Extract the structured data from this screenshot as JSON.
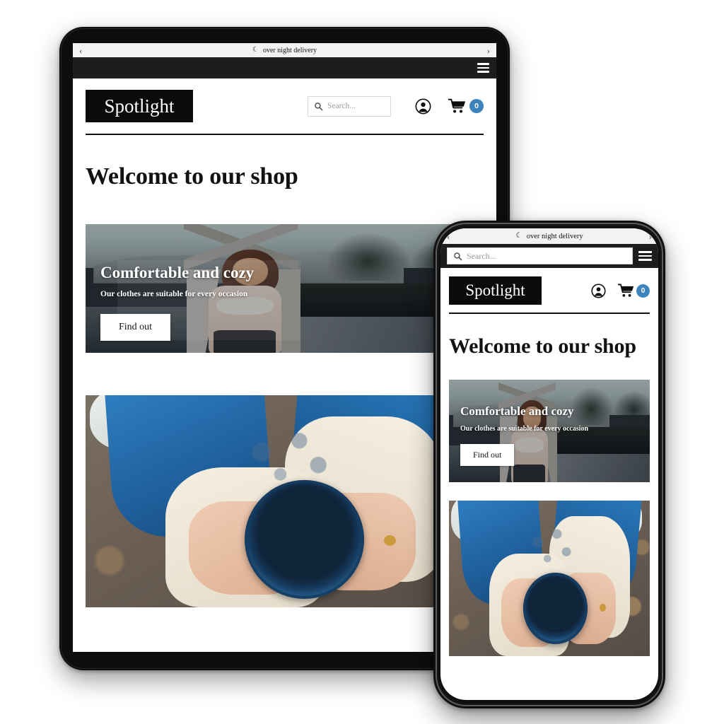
{
  "brand": {
    "name": "Spotlight",
    "accent_badge_color": "#3d84bd",
    "ink": "#0b0b0b"
  },
  "announcement": {
    "text": "over night delivery",
    "moon_icon": "☾",
    "prev_arrow": "‹",
    "next_arrow": "›"
  },
  "search": {
    "placeholder": "Search...",
    "value": ""
  },
  "header": {
    "account_label": "Account",
    "cart_label": "Cart",
    "cart_count": "0",
    "menu_label": "Menu"
  },
  "page": {
    "heading": "Welcome to our shop"
  },
  "banners": [
    {
      "title": "Comfortable and cozy",
      "subtitle": "Our clothes are suitable for every occasion",
      "button": "Find out",
      "image_alt": "woman stretching outdoors at dusk"
    },
    {
      "title": "",
      "subtitle": "",
      "button": "",
      "image_alt": "hands in knit mittens holding a blue enamel mug"
    }
  ],
  "devices": {
    "tablet_label": "Tablet preview",
    "phone_label": "Phone preview"
  }
}
